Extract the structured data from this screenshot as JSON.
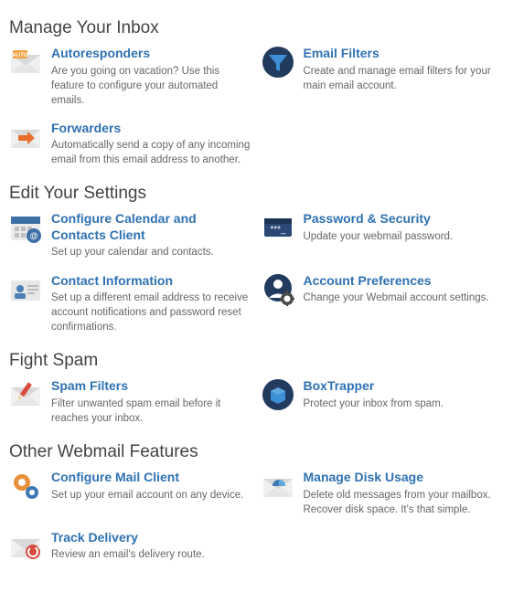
{
  "sections": [
    {
      "title": "Manage Your Inbox",
      "items": [
        {
          "title": "Autoresponders",
          "desc": "Are you going on vacation? Use this feature to configure your automated emails."
        },
        {
          "title": "Email Filters",
          "desc": "Create and manage email filters for your main email account."
        },
        {
          "title": "Forwarders",
          "desc": "Automatically send a copy of any incoming email from this email address to another."
        }
      ]
    },
    {
      "title": "Edit Your Settings",
      "items": [
        {
          "title": "Configure Calendar and Contacts Client",
          "desc": "Set up your calendar and contacts."
        },
        {
          "title": "Password & Security",
          "desc": "Update your webmail password."
        },
        {
          "title": "Contact Information",
          "desc": "Set up a different email address to receive account notifications and password reset confirmations."
        },
        {
          "title": "Account Preferences",
          "desc": "Change your Webmail account settings."
        }
      ]
    },
    {
      "title": "Fight Spam",
      "items": [
        {
          "title": "Spam Filters",
          "desc": "Filter unwanted spam email before it reaches your inbox."
        },
        {
          "title": "BoxTrapper",
          "desc": "Protect your inbox from spam."
        }
      ]
    },
    {
      "title": "Other Webmail Features",
      "items": [
        {
          "title": "Configure Mail Client",
          "desc": "Set up your email account on any device."
        },
        {
          "title": "Manage Disk Usage",
          "desc": "Delete old messages from your mailbox. Recover disk space. It's that simple."
        },
        {
          "title": "Track Delivery",
          "desc": "Review an email's delivery route."
        }
      ]
    }
  ]
}
